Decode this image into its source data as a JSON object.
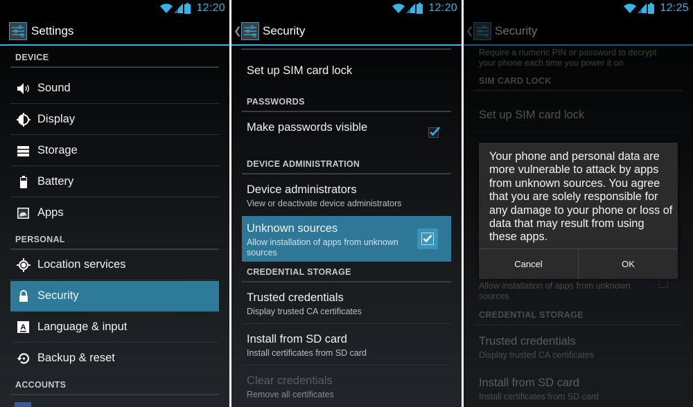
{
  "colors": {
    "accent": "#33b5e5",
    "selected": "#2d7a99",
    "background": "#000000"
  },
  "panels": [
    {
      "status": {
        "time": "12:20",
        "icons": [
          "wifi-icon",
          "signal-icon",
          "battery-icon"
        ]
      },
      "actionbar": {
        "title": "Settings",
        "icon": "settings-sliders-icon",
        "has_up": false
      },
      "categories": [
        "DEVICE",
        "PERSONAL",
        "ACCOUNTS"
      ],
      "items": [
        {
          "label": "Sound",
          "icon": "sound-icon"
        },
        {
          "label": "Display",
          "icon": "display-brightness-icon"
        },
        {
          "label": "Storage",
          "icon": "storage-icon"
        },
        {
          "label": "Battery",
          "icon": "battery-icon"
        },
        {
          "label": "Apps",
          "icon": "apps-icon"
        },
        {
          "label": "Location services",
          "icon": "location-icon"
        },
        {
          "label": "Security",
          "icon": "lock-icon",
          "selected": true
        },
        {
          "label": "Language & input",
          "icon": "language-icon"
        },
        {
          "label": "Backup & reset",
          "icon": "backup-icon"
        }
      ]
    },
    {
      "status": {
        "time": "12:20",
        "icons": [
          "wifi-icon",
          "signal-icon",
          "battery-icon"
        ]
      },
      "actionbar": {
        "title": "Security",
        "icon": "settings-sliders-icon",
        "has_up": true,
        "up_glyph": "❮"
      },
      "sim_lock": {
        "title": "Set up SIM card lock"
      },
      "categories": [
        "PASSWORDS",
        "DEVICE ADMINISTRATION",
        "CREDENTIAL STORAGE"
      ],
      "make_passwords_visible": {
        "title": "Make passwords visible",
        "checked": true
      },
      "device_admins": {
        "title": "Device administrators",
        "summary": "View or deactivate device administrators"
      },
      "unknown_sources": {
        "title": "Unknown sources",
        "summary": "Allow installation of apps from unknown sources",
        "checked": true,
        "selected": true
      },
      "trusted_credentials": {
        "title": "Trusted credentials",
        "summary": "Display trusted CA certificates"
      },
      "install_sd": {
        "title": "Install from SD card",
        "summary": "Install certificates from SD card"
      },
      "clear_credentials": {
        "title": "Clear credentials",
        "summary": "Remove all certificates",
        "enabled": false
      }
    },
    {
      "status": {
        "time": "12:25",
        "icons": [
          "wifi-icon",
          "signal-icon",
          "battery-icon"
        ]
      },
      "actionbar": {
        "title": "Security",
        "icon": "settings-sliders-icon",
        "has_up": true,
        "up_glyph": "❮"
      },
      "encrypt_summary": "Require a numeric PIN or password to decrypt your phone each time you power it on",
      "categories": [
        "SIM CARD LOCK",
        "CREDENTIAL STORAGE"
      ],
      "sim_lock": {
        "title": "Set up SIM card lock"
      },
      "unknown_sources": {
        "summary": "Allow installation of apps from unknown sources",
        "checked": false
      },
      "trusted_credentials": {
        "title": "Trusted credentials",
        "summary": "Display trusted CA certificates"
      },
      "install_sd": {
        "title": "Install from SD card",
        "summary": "Install certificates from SD card"
      },
      "dialog": {
        "message": "Your phone and personal data are more vulnerable to attack by apps from unknown sources. You agree that you are solely responsible for any damage to your phone or loss of data that may result from using these apps.",
        "cancel_label": "Cancel",
        "ok_label": "OK"
      }
    }
  ]
}
